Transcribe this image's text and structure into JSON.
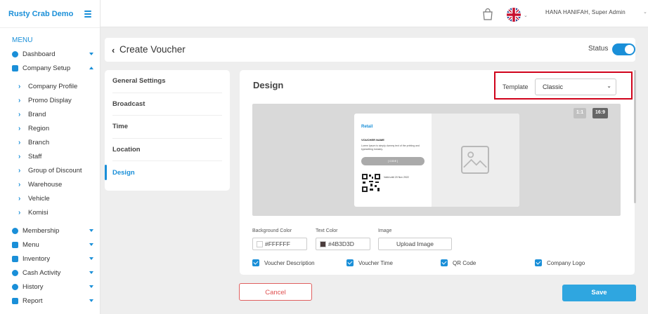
{
  "app": {
    "title": "Rusty Crab Demo"
  },
  "topbar": {
    "user": "HANA HANIFAH, Super Admin"
  },
  "sidebar": {
    "menu_title": "MENU",
    "items": [
      {
        "label": "Dashboard",
        "icon": "dashboard-icon"
      },
      {
        "label": "Company Setup",
        "icon": "building-icon",
        "expanded": true
      }
    ],
    "company_sub": [
      "Company Profile",
      "Promo Display",
      "Brand",
      "Region",
      "Branch",
      "Staff",
      "Group of Discount",
      "Warehouse",
      "Vehicle",
      "Komisi"
    ],
    "bottom_items": [
      {
        "label": "Membership",
        "icon": "users-icon"
      },
      {
        "label": "Menu",
        "icon": "utensils-icon"
      },
      {
        "label": "Inventory",
        "icon": "inventory-icon"
      },
      {
        "label": "Cash Activity",
        "icon": "dollar-icon"
      },
      {
        "label": "History",
        "icon": "history-icon"
      },
      {
        "label": "Report",
        "icon": "report-icon"
      }
    ]
  },
  "header": {
    "title": "Create Voucher",
    "status_label": "Status",
    "status_on": true
  },
  "tabs": [
    "General Settings",
    "Broadcast",
    "Time",
    "Location",
    "Design"
  ],
  "design": {
    "title": "Design",
    "template_label": "Template",
    "template_value": "Classic",
    "ratios": [
      "1:1",
      "16:9"
    ],
    "voucher": {
      "logo": "Retail",
      "name": "VOUCHER NAME",
      "desc": "Lorem Ipsum is simply dummy text of the printing and typesetting industry.",
      "button": "[ CODE ]",
      "time": "Valid until 20 Nov 2022"
    },
    "bg_color_label": "Background Color",
    "bg_color_value": "#FFFFFF",
    "text_color_label": "Text Color",
    "text_color_value": "#4B3D3D",
    "image_label": "Image",
    "upload_label": "Upload Image",
    "checks": [
      "Voucher Description",
      "Voucher Time",
      "QR Code",
      "Company Logo"
    ]
  },
  "actions": {
    "cancel": "Cancel",
    "save": "Save"
  },
  "colors": {
    "accent": "#1a8fd8",
    "danger": "#d0021b",
    "save": "#2fa6e0"
  }
}
